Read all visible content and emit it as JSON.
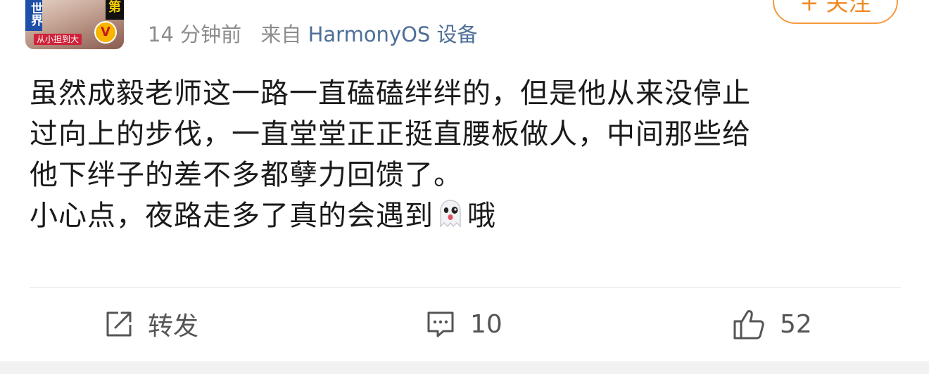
{
  "header": {
    "avatar": {
      "tag_left": "世界",
      "tag_right": "第",
      "ribbon": "从小担到大",
      "badge": "V"
    },
    "time": "14 分钟前",
    "source_prefix": "来自",
    "source_device": "HarmonyOS 设备",
    "follow_label": "+ 关注"
  },
  "post": {
    "lines": [
      "虽然成毅老师这一路一直磕磕绊绊的，但是他从来没停止",
      "过向上的步伐，一直堂堂正正挺直腰板做人，中间那些给",
      "他下绊子的差不多都孽力回馈了。"
    ],
    "last_line_before_emoji": "小心点，夜路走多了真的会遇到",
    "emoji": "ghost-emoji",
    "last_line_after_emoji": "哦"
  },
  "actions": {
    "repost_label": "转发",
    "comment_count": "10",
    "like_count": "52"
  },
  "colors": {
    "accent_orange": "#f08a24",
    "link_blue": "#4e6f97",
    "meta_gray": "#8c8c8c"
  }
}
